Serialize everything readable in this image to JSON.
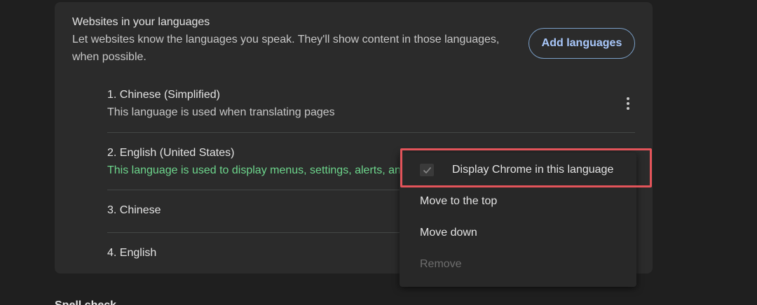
{
  "section": {
    "title": "Websites in your languages",
    "description": "Let websites know the languages you speak. They'll show content in those languages, when possible.",
    "add_button_label": "Add languages"
  },
  "languages": [
    {
      "name": "1. Chinese (Simplified)",
      "subtitle": "This language is used when translating pages"
    },
    {
      "name": "2. English (United States)",
      "subtitle": "This language is used to display menus, settings, alerts, an"
    },
    {
      "name": "3. Chinese",
      "subtitle": ""
    },
    {
      "name": "4. English",
      "subtitle": ""
    }
  ],
  "menu": {
    "items": [
      {
        "label": "Display Chrome in this language",
        "checked": true,
        "disabled": false
      },
      {
        "label": "Move to the top",
        "disabled": false
      },
      {
        "label": "Move down",
        "disabled": false
      },
      {
        "label": "Remove",
        "disabled": true
      }
    ]
  },
  "next_section_partial": "Spell check",
  "colors": {
    "background": "#1f1f1f",
    "card": "#2b2b2b",
    "accent": "#a8c7fa",
    "green_text": "#6dd58c",
    "highlight": "#e3545a"
  },
  "icons": {
    "more": "more-vert-icon",
    "check": "check-icon"
  }
}
